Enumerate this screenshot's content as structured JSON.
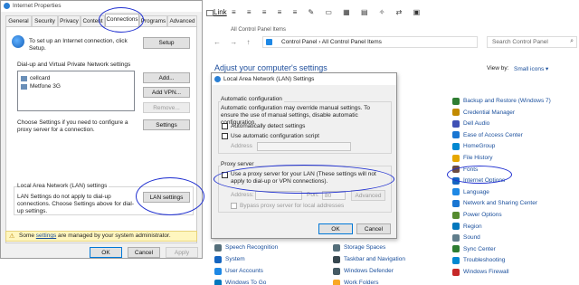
{
  "cp_window": {
    "toolbar_link": "Link",
    "address": "Control Panel  ›  All Control Panel Items",
    "title_crumb": "All Control Panel Items",
    "search_placeholder": "Search Control Panel",
    "heading": "Adjust your computer's settings",
    "view_by_label": "View by:",
    "view_by_value": "Small icons ▾",
    "items_right": [
      {
        "label": "Backup and Restore (Windows 7)",
        "color": "#2e7d32"
      },
      {
        "label": "Credential Manager",
        "color": "#c28a00"
      },
      {
        "label": "Dell Audio",
        "color": "#3f51b5"
      },
      {
        "label": "Ease of Access Center",
        "color": "#1976d2"
      },
      {
        "label": "HomeGroup",
        "color": "#0288d1"
      },
      {
        "label": "File History",
        "color": "#e6a700"
      },
      {
        "label": "Fonts",
        "color": "#6d4c41"
      },
      {
        "label": "Internet Options",
        "color": "#1565c0"
      },
      {
        "label": "Language",
        "color": "#1e88e5"
      },
      {
        "label": "Network and Sharing Center",
        "color": "#1976d2"
      },
      {
        "label": "Power Options",
        "color": "#558b2f"
      },
      {
        "label": "Region",
        "color": "#0277bd"
      },
      {
        "label": "Sound",
        "color": "#607d8b"
      },
      {
        "label": "Sync Center",
        "color": "#2e7d32"
      },
      {
        "label": "Troubleshooting",
        "color": "#0288d1"
      },
      {
        "label": "Windows Firewall",
        "color": "#c62828"
      }
    ],
    "items_bottom_mid": [
      {
        "label": "Speech Recognition",
        "color": "#546e7a"
      },
      {
        "label": "System",
        "color": "#1565c0"
      },
      {
        "label": "User Accounts",
        "color": "#1e88e5"
      },
      {
        "label": "Windows To Go",
        "color": "#0277bd"
      }
    ],
    "items_bottom_right": [
      {
        "label": "Storage Spaces",
        "color": "#546e7a"
      },
      {
        "label": "Taskbar and Navigation",
        "color": "#37474f"
      },
      {
        "label": "Windows Defender",
        "color": "#455a64"
      },
      {
        "label": "Work Folders",
        "color": "#f9a825"
      }
    ]
  },
  "inet": {
    "title": "Internet Properties",
    "tabs": [
      "General",
      "Security",
      "Privacy",
      "Content",
      "Connections",
      "Programs",
      "Advanced"
    ],
    "setup_text": "To set up an Internet connection, click Setup.",
    "setup_button": "Setup",
    "dialup_heading": "Dial-up and Virtual Private Network settings",
    "connections": [
      "cellcard",
      "Metfone 3G"
    ],
    "add_button": "Add...",
    "add_vpn_button": "Add VPN...",
    "remove_button": "Remove...",
    "proxy_text": "Choose Settings if you need to configure a proxy server for a connection.",
    "settings_button": "Settings",
    "lan_heading": "Local Area Network (LAN) settings",
    "lan_text": "LAN Settings do not apply to dial-up connections. Choose Settings above for dial-up settings.",
    "lan_button": "LAN settings",
    "admin_note_prefix": "Some ",
    "admin_note_link": "settings",
    "admin_note_suffix": " are managed by your system administrator.",
    "ok": "OK",
    "cancel": "Cancel",
    "apply": "Apply"
  },
  "lan": {
    "title": "Local Area Network (LAN) Settings",
    "auto_config_label": "Automatic configuration",
    "auto_config_text": "Automatic configuration may override manual settings. To ensure the use of manual settings, disable automatic configuration.",
    "auto_detect": "Automatically detect settings",
    "use_script": "Use automatic configuration script",
    "address_label": "Address",
    "proxy_label": "Proxy server",
    "use_proxy": "Use a proxy server for your LAN (These settings will not apply to dial-up or VPN connections).",
    "address2_label": "Address:",
    "port_label": "Port:",
    "port_value": "80",
    "advanced": "Advanced",
    "bypass": "Bypass proxy server for local addresses",
    "ok": "OK",
    "cancel": "Cancel"
  }
}
